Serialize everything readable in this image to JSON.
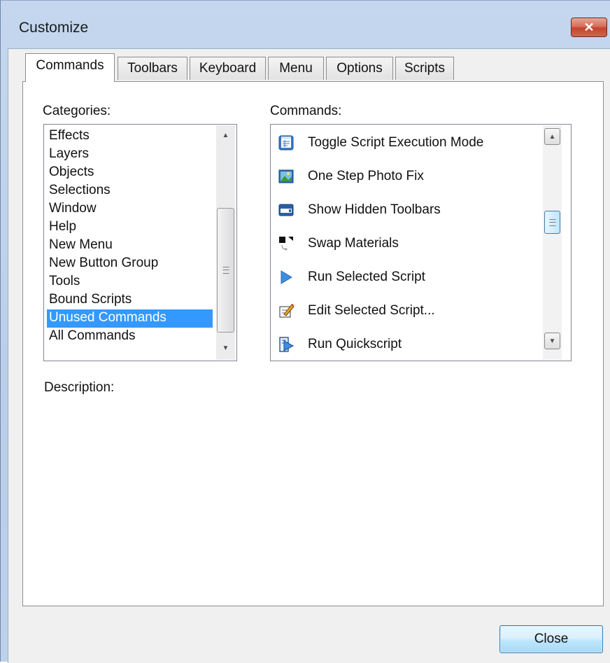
{
  "window": {
    "title": "Customize",
    "close_glyph": "✕"
  },
  "tabs": [
    {
      "label": "Commands",
      "active": true
    },
    {
      "label": "Toolbars",
      "active": false
    },
    {
      "label": "Keyboard",
      "active": false
    },
    {
      "label": "Menu",
      "active": false
    },
    {
      "label": "Options",
      "active": false
    },
    {
      "label": "Scripts",
      "active": false
    }
  ],
  "categories": {
    "label": "Categories:",
    "items": [
      "Effects",
      "Layers",
      "Objects",
      "Selections",
      "Window",
      "Help",
      "New Menu",
      "New Button Group",
      "Tools",
      "Bound Scripts",
      "Unused Commands",
      "All Commands"
    ],
    "selected": "Unused Commands"
  },
  "commands": {
    "label": "Commands:",
    "items": [
      {
        "label": "Toggle Script Execution Mode",
        "icon": "script-mode-icon"
      },
      {
        "label": "One Step Photo Fix",
        "icon": "photo-fix-icon"
      },
      {
        "label": "Show Hidden Toolbars",
        "icon": "toolbar-icon"
      },
      {
        "label": "Swap Materials",
        "icon": "swap-materials-icon"
      },
      {
        "label": "Run Selected Script",
        "icon": "play-icon"
      },
      {
        "label": "Edit Selected Script...",
        "icon": "edit-script-icon"
      },
      {
        "label": "Run Quickscript",
        "icon": "quickscript-icon"
      }
    ]
  },
  "description": {
    "label": "Description:"
  },
  "footer": {
    "close_label": "Close"
  },
  "colors": {
    "selection": "#3399ff",
    "title_close": "#c3442e",
    "dialog_frame": "#b9cfe9"
  }
}
